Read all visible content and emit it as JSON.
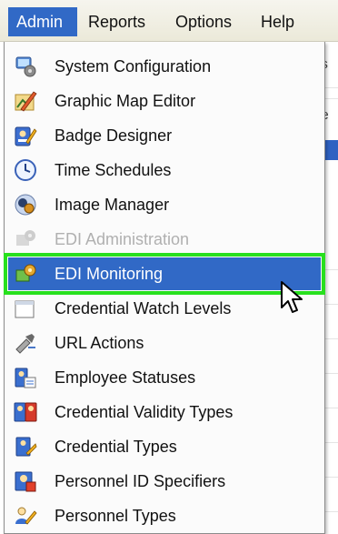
{
  "menubar": {
    "items": [
      {
        "label": "Admin",
        "active": true
      },
      {
        "label": "Reports"
      },
      {
        "label": "Options"
      },
      {
        "label": "Help"
      }
    ]
  },
  "background_window": {
    "fragments": [
      "es",
      "ne"
    ]
  },
  "admin_menu": {
    "items": [
      {
        "label": "System Configuration",
        "icon": "system-configuration-icon"
      },
      {
        "label": "Graphic Map Editor",
        "icon": "map-editor-icon"
      },
      {
        "label": "Badge Designer",
        "icon": "badge-designer-icon"
      },
      {
        "label": "Time Schedules",
        "icon": "clock-icon"
      },
      {
        "label": "Image Manager",
        "icon": "image-manager-icon"
      },
      {
        "label": "EDI Administration",
        "icon": "edi-administration-icon",
        "disabled": true
      },
      {
        "label": "EDI Monitoring",
        "icon": "edi-monitoring-icon",
        "highlighted": true
      },
      {
        "label": "Credential Watch Levels",
        "icon": "credential-watch-icon"
      },
      {
        "label": "URL Actions",
        "icon": "url-actions-icon"
      },
      {
        "label": "Employee Statuses",
        "icon": "employee-statuses-icon"
      },
      {
        "label": "Credential Validity Types",
        "icon": "credential-validity-icon"
      },
      {
        "label": "Credential Types",
        "icon": "credential-types-icon"
      },
      {
        "label": "Personnel ID Specifiers",
        "icon": "personnel-id-icon"
      },
      {
        "label": "Personnel Types",
        "icon": "personnel-types-icon"
      }
    ]
  },
  "colors": {
    "selection": "#3169c6",
    "highlight_outline": "#28e01e",
    "disabled_text": "#b0b0b0"
  }
}
